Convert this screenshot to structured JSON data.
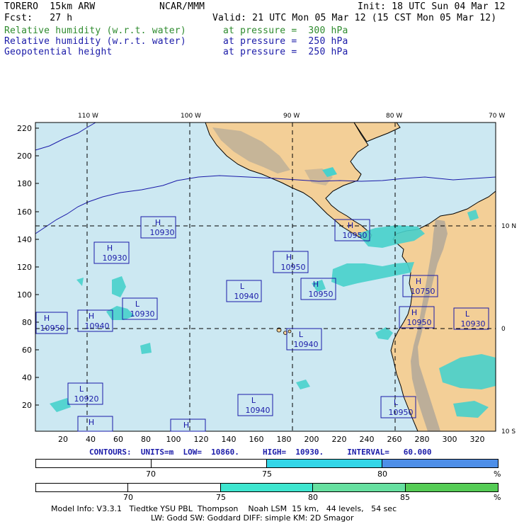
{
  "header": {
    "model": "TORERO  15km ARW",
    "org": "NCAR/MMM",
    "init": "Init: 18 UTC Sun 04 Mar 12",
    "fcst": "Fcst:   27 h",
    "valid": "Valid: 21 UTC Mon 05 Mar 12 (15 CST Mon 05 Mar 12)",
    "fields": [
      {
        "name": "Relative humidity (w.r.t. water)",
        "level": "at pressure =  300 hPa",
        "color": "#2e8b2e"
      },
      {
        "name": "Relative humidity (w.r.t. water)",
        "level": "at pressure =  250 hPa",
        "color": "#1a1aa8"
      },
      {
        "name": "Geopotential height",
        "level": "at pressure =  250 hPa",
        "color": "#1a1aa8"
      }
    ]
  },
  "map": {
    "top_labels": [
      "110 W",
      "100 W",
      "90 W",
      "80 W",
      "70 W"
    ],
    "left_ticks": [
      "220",
      "200",
      "180",
      "160",
      "140",
      "120",
      "100",
      "80",
      "60",
      "40",
      "20"
    ],
    "bottom_ticks": [
      "20",
      "40",
      "60",
      "80",
      "100",
      "120",
      "140",
      "160",
      "180",
      "200",
      "220",
      "240",
      "260",
      "280",
      "300",
      "320"
    ],
    "right_labels": [
      "10 N",
      "0",
      "10 S"
    ],
    "colors": {
      "ocean": "#cce8f2",
      "land": "#f3cf97",
      "terrain": "#a9a39a",
      "rh_high": "#48d1cc",
      "rh_mid": "#5ce0c8",
      "box": "#1a1aa8"
    },
    "pressure_systems": [
      {
        "type": "H",
        "value": "10930"
      },
      {
        "type": "H",
        "value": "10930"
      },
      {
        "type": "H",
        "value": "10950"
      },
      {
        "type": "L",
        "value": "10940"
      },
      {
        "type": "H",
        "value": "10950"
      },
      {
        "type": "L",
        "value": "10930"
      },
      {
        "type": "H",
        "value": "10950"
      },
      {
        "type": "H",
        "value": "10940"
      },
      {
        "type": "H",
        "value": "10950"
      },
      {
        "type": "H",
        "value": "10750"
      },
      {
        "type": "H",
        "value": "10950"
      },
      {
        "type": "L",
        "value": "10930"
      },
      {
        "type": "L",
        "value": "10940"
      },
      {
        "type": "L",
        "value": "10920"
      },
      {
        "type": "L",
        "value": "10940"
      },
      {
        "type": "L",
        "value": "10950"
      },
      {
        "type": "H",
        "value": "10930"
      },
      {
        "type": "H",
        "value": ""
      }
    ]
  },
  "contours": {
    "text": "CONTOURS:  UNITS=m  LOW=  10860.     HIGH=  10930.     INTERVAL=   60.000"
  },
  "colorbars": [
    {
      "ticks": [
        "70",
        "75",
        "80"
      ],
      "unit": "%",
      "colors": [
        "#ffffff",
        "#ffffff",
        "#33d6e8",
        "#33d6e8",
        "#4e8fe8",
        "#4e8fe8"
      ]
    },
    {
      "ticks": [
        "70",
        "75",
        "80",
        "85"
      ],
      "unit": "%",
      "colors": [
        "#ffffff",
        "#ffffff",
        "#3ee6cf",
        "#3ee6cf",
        "#66e0a0",
        "#55cc55"
      ]
    }
  ],
  "footer": {
    "line1": "Model Info: V3.3.1   Tiedtke YSU PBL  Thompson    Noah LSM  15 km,   44 levels,   54 sec",
    "line2": "LW: Godd SW: Goddard DIFF: simple KM: 2D Smagor"
  }
}
